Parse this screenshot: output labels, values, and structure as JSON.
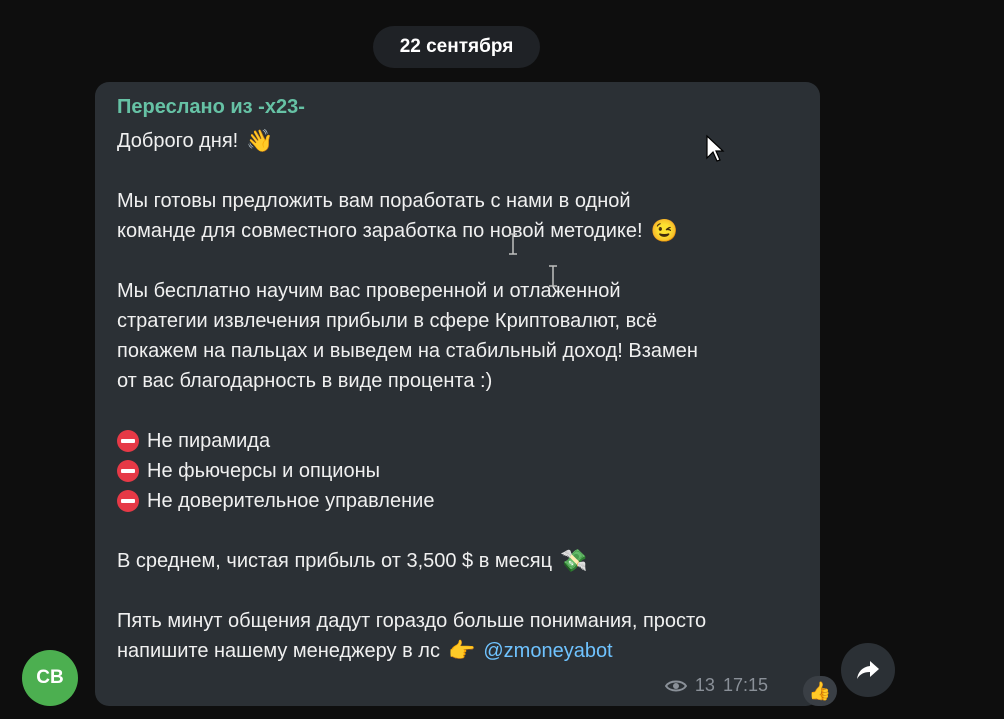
{
  "date_label": "22 сентября",
  "message": {
    "forwarded_label": "Переслано из -x23-",
    "lines": {
      "l1": "Доброго дня!",
      "l2": "Мы готовы предложить вам поработать с нами в одной",
      "l3": "команде для совместного заработка по новой методике!",
      "l4": "Мы бесплатно научим вас проверенной и отлаженной",
      "l5": "стратегии извлечения прибыли в сфере Криптовалют, всё",
      "l6": "покажем на пальцах и выведем на стабильный доход! Взамен",
      "l7": "от вас благодарность в виде процента :)",
      "b1": "Не пирамида",
      "b2": "Не фьючерсы и опционы",
      "b3": "Не доверительное управление",
      "l8": "В среднем, чистая прибыль от 3,500 $ в месяц",
      "l9": "Пять минут общения дадут гораздо больше понимания, просто",
      "l10": "напишите нашему менеджеру в лс",
      "mention": "@zmoneyabot"
    },
    "emojis": {
      "wave": "👋",
      "wink": "😉",
      "money": "💸",
      "point": "👉",
      "thumbs": "👍"
    },
    "views": "13",
    "time": "17:15"
  },
  "avatar_initials": "CB",
  "colors": {
    "background": "#0e0e0e",
    "bubble": "#2b3035",
    "forward_name": "#66c2a5",
    "mention": "#6fc3ff",
    "avatar": "#4caf50",
    "no_entry": "#e63946"
  },
  "icons": [
    "eye-icon",
    "share-icon",
    "no-entry-icon",
    "cursor-arrow-icon",
    "text-cursor-icon"
  ]
}
